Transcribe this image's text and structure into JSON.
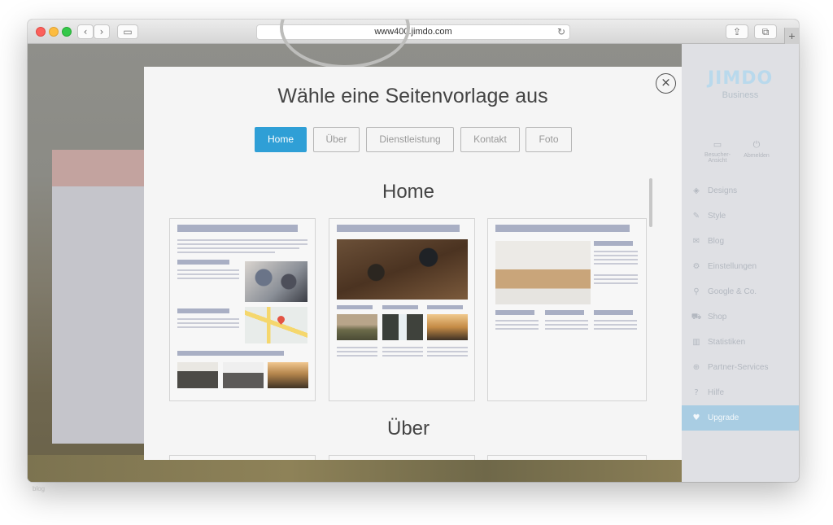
{
  "browser": {
    "url": "www400.jimdo.com",
    "back_glyph": "‹",
    "forward_glyph": "›",
    "sidebar_glyph": "▭",
    "reload_glyph": "↻",
    "share_glyph": "⇪",
    "tabs_glyph": "⧉",
    "new_tab_glyph": "+"
  },
  "sidebar": {
    "logo": "JIMDO",
    "plan": "Business",
    "top_actions": [
      {
        "icon": "monitor-icon",
        "glyph": "▭",
        "label": "Besucher-Ansicht"
      },
      {
        "icon": "power-icon",
        "glyph": "⏻",
        "label": "Abmelden"
      }
    ],
    "items": [
      {
        "label": "Designs",
        "icon": "designs-icon",
        "glyph": "◈"
      },
      {
        "label": "Style",
        "icon": "style-icon",
        "glyph": "✎"
      },
      {
        "label": "Blog",
        "icon": "blog-icon",
        "glyph": "✉"
      },
      {
        "label": "Einstellungen",
        "icon": "gear-icon",
        "glyph": "⚙"
      },
      {
        "label": "Google & Co.",
        "icon": "search-icon",
        "glyph": "⚲"
      },
      {
        "label": "Shop",
        "icon": "cart-icon",
        "glyph": "⛟"
      },
      {
        "label": "Statistiken",
        "icon": "chart-icon",
        "glyph": "▥"
      },
      {
        "label": "Partner-Services",
        "icon": "plus-circle-icon",
        "glyph": "⊕"
      },
      {
        "label": "Hilfe",
        "icon": "help-icon",
        "glyph": "?"
      },
      {
        "label": "Upgrade",
        "icon": "heart-icon",
        "glyph": "♥"
      }
    ]
  },
  "modal": {
    "title": "Wähle eine Seitenvorlage aus",
    "close_glyph": "×",
    "tabs": [
      "Home",
      "Über",
      "Dienstleistung",
      "Kontakt",
      "Foto"
    ],
    "active_tab": "Home",
    "sections": [
      "Home",
      "Über"
    ]
  },
  "footer_badge": "blog",
  "colors": {
    "accent": "#2f9fd6",
    "upgrade_highlight": "#a9cde3"
  }
}
